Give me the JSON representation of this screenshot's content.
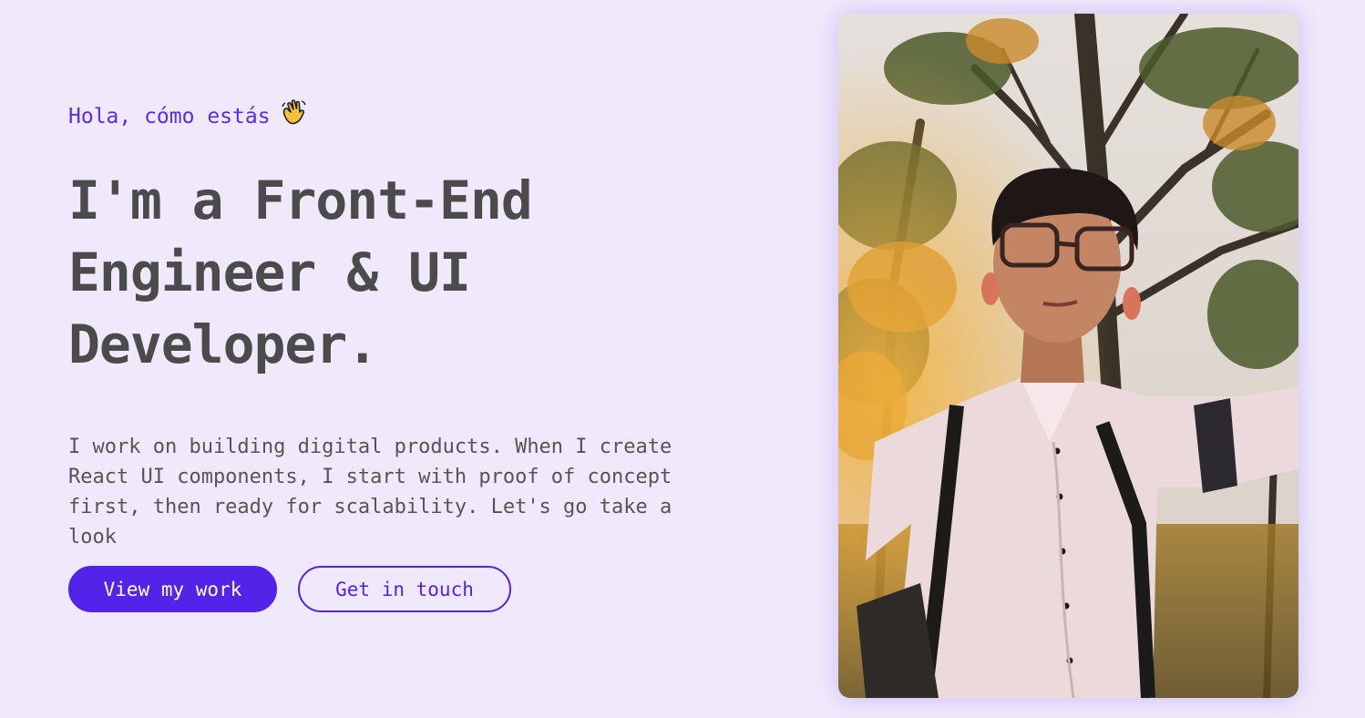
{
  "hero": {
    "greeting": "Hola, cómo estás",
    "headline": "I'm a Front-End Engineer & UI Developer.",
    "intro": "I work on building digital products. When I create React UI components, I start with proof of concept first, then ready for scalability. Let's go take a look"
  },
  "actions": {
    "primary_label": "View my work",
    "secondary_label": "Get in touch"
  },
  "icons": {
    "greeting_icon": "waving-hand-icon"
  },
  "colors": {
    "background": "#efe9fb",
    "accent": "#5323ea",
    "heading": "#4b4b4b",
    "body_text": "#555555"
  }
}
